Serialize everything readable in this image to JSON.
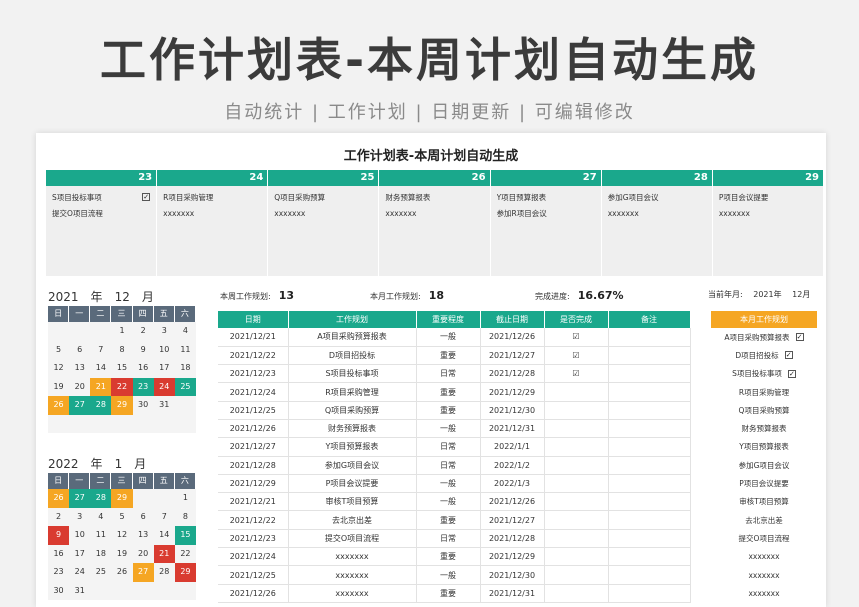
{
  "hero": {
    "title": "工作计划表-本周计划自动生成",
    "subtitle": "自动统计 | 工作计划 | 日期更新 | 可编辑修改"
  },
  "sheet": {
    "title": "工作计划表-本周计划自动生成"
  },
  "week": {
    "days": [
      "23",
      "24",
      "25",
      "26",
      "27",
      "28",
      "29"
    ],
    "items": [
      [
        {
          "text": "S项目投标事项",
          "done": true
        },
        {
          "text": "提交O项目流程",
          "done": false
        }
      ],
      [
        {
          "text": "R项目采购管理",
          "done": false
        },
        {
          "text": "xxxxxxx",
          "done": false
        }
      ],
      [
        {
          "text": "Q项目采购预算",
          "done": false
        },
        {
          "text": "xxxxxxx",
          "done": false
        }
      ],
      [
        {
          "text": "财务预算报表",
          "done": false
        },
        {
          "text": "xxxxxxx",
          "done": false
        }
      ],
      [
        {
          "text": "Y项目预算报表",
          "done": false
        },
        {
          "text": "参加R项目会议",
          "done": false
        }
      ],
      [
        {
          "text": "参加G项目会议",
          "done": false
        },
        {
          "text": "xxxxxxx",
          "done": false
        }
      ],
      [
        {
          "text": "P项目会议提要",
          "done": false
        },
        {
          "text": "xxxxxxx",
          "done": false
        }
      ]
    ]
  },
  "calendars": [
    {
      "year": "2021",
      "year_label": "年",
      "month": "12",
      "month_label": "月",
      "dows": [
        "日",
        "一",
        "二",
        "三",
        "四",
        "五",
        "六"
      ],
      "days": [
        {
          "t": "",
          "c": ""
        },
        {
          "t": "",
          "c": ""
        },
        {
          "t": "",
          "c": ""
        },
        {
          "t": "1",
          "c": ""
        },
        {
          "t": "2",
          "c": ""
        },
        {
          "t": "3",
          "c": ""
        },
        {
          "t": "4",
          "c": ""
        },
        {
          "t": "5",
          "c": ""
        },
        {
          "t": "6",
          "c": ""
        },
        {
          "t": "7",
          "c": ""
        },
        {
          "t": "8",
          "c": ""
        },
        {
          "t": "9",
          "c": ""
        },
        {
          "t": "10",
          "c": ""
        },
        {
          "t": "11",
          "c": ""
        },
        {
          "t": "12",
          "c": ""
        },
        {
          "t": "13",
          "c": ""
        },
        {
          "t": "14",
          "c": ""
        },
        {
          "t": "15",
          "c": ""
        },
        {
          "t": "16",
          "c": ""
        },
        {
          "t": "17",
          "c": ""
        },
        {
          "t": "18",
          "c": ""
        },
        {
          "t": "19",
          "c": ""
        },
        {
          "t": "20",
          "c": ""
        },
        {
          "t": "21",
          "c": "orange"
        },
        {
          "t": "22",
          "c": "red"
        },
        {
          "t": "23",
          "c": "green"
        },
        {
          "t": "24",
          "c": "red"
        },
        {
          "t": "25",
          "c": "green"
        },
        {
          "t": "26",
          "c": "orange"
        },
        {
          "t": "27",
          "c": "green"
        },
        {
          "t": "28",
          "c": "green"
        },
        {
          "t": "29",
          "c": "orange"
        },
        {
          "t": "30",
          "c": ""
        },
        {
          "t": "31",
          "c": ""
        },
        {
          "t": "",
          "c": ""
        },
        {
          "t": "",
          "c": ""
        },
        {
          "t": "",
          "c": ""
        },
        {
          "t": "",
          "c": ""
        },
        {
          "t": "",
          "c": ""
        },
        {
          "t": "",
          "c": ""
        },
        {
          "t": "",
          "c": ""
        },
        {
          "t": "",
          "c": ""
        }
      ]
    },
    {
      "year": "2022",
      "year_label": "年",
      "month": "1",
      "month_label": "月",
      "dows": [
        "日",
        "一",
        "二",
        "三",
        "四",
        "五",
        "六"
      ],
      "days": [
        {
          "t": "26",
          "c": "orange"
        },
        {
          "t": "27",
          "c": "green"
        },
        {
          "t": "28",
          "c": "green"
        },
        {
          "t": "29",
          "c": "orange"
        },
        {
          "t": "",
          "c": ""
        },
        {
          "t": "",
          "c": ""
        },
        {
          "t": "1",
          "c": ""
        },
        {
          "t": "2",
          "c": ""
        },
        {
          "t": "3",
          "c": ""
        },
        {
          "t": "4",
          "c": ""
        },
        {
          "t": "5",
          "c": ""
        },
        {
          "t": "6",
          "c": ""
        },
        {
          "t": "7",
          "c": ""
        },
        {
          "t": "8",
          "c": ""
        },
        {
          "t": "9",
          "c": "red"
        },
        {
          "t": "10",
          "c": ""
        },
        {
          "t": "11",
          "c": ""
        },
        {
          "t": "12",
          "c": ""
        },
        {
          "t": "13",
          "c": ""
        },
        {
          "t": "14",
          "c": ""
        },
        {
          "t": "15",
          "c": "green"
        },
        {
          "t": "16",
          "c": ""
        },
        {
          "t": "17",
          "c": ""
        },
        {
          "t": "18",
          "c": ""
        },
        {
          "t": "19",
          "c": ""
        },
        {
          "t": "20",
          "c": ""
        },
        {
          "t": "21",
          "c": "red"
        },
        {
          "t": "22",
          "c": ""
        },
        {
          "t": "23",
          "c": ""
        },
        {
          "t": "24",
          "c": ""
        },
        {
          "t": "25",
          "c": ""
        },
        {
          "t": "26",
          "c": ""
        },
        {
          "t": "27",
          "c": "orange"
        },
        {
          "t": "28",
          "c": ""
        },
        {
          "t": "29",
          "c": "red"
        },
        {
          "t": "30",
          "c": ""
        },
        {
          "t": "31",
          "c": ""
        },
        {
          "t": "",
          "c": ""
        },
        {
          "t": "",
          "c": ""
        },
        {
          "t": "",
          "c": ""
        },
        {
          "t": "",
          "c": ""
        },
        {
          "t": "",
          "c": ""
        }
      ]
    }
  ],
  "stats": {
    "week_label": "本周工作规划:",
    "week_value": "13",
    "month_label": "本月工作规划:",
    "month_value": "18",
    "progress_label": "完成进度:",
    "progress_value": "16.67%",
    "current_label": "当前年月:",
    "current_year": "2021年",
    "current_month": "12月"
  },
  "table": {
    "headers": [
      "日期",
      "工作规划",
      "重要程度",
      "截止日期",
      "是否完成",
      "备注"
    ],
    "rows": [
      [
        "2021/12/21",
        "A项目采购预算报表",
        "一般",
        "2021/12/26",
        "☑",
        ""
      ],
      [
        "2021/12/22",
        "D项目招投标",
        "重要",
        "2021/12/27",
        "☑",
        ""
      ],
      [
        "2021/12/23",
        "S项目投标事项",
        "日常",
        "2021/12/28",
        "☑",
        ""
      ],
      [
        "2021/12/24",
        "R项目采购管理",
        "重要",
        "2021/12/29",
        "",
        ""
      ],
      [
        "2021/12/25",
        "Q项目采购预算",
        "重要",
        "2021/12/30",
        "",
        ""
      ],
      [
        "2021/12/26",
        "财务预算报表",
        "一般",
        "2021/12/31",
        "",
        ""
      ],
      [
        "2021/12/27",
        "Y项目预算报表",
        "日常",
        "2022/1/1",
        "",
        ""
      ],
      [
        "2021/12/28",
        "参加G项目会议",
        "日常",
        "2022/1/2",
        "",
        ""
      ],
      [
        "2021/12/29",
        "P项目会议提要",
        "一般",
        "2022/1/3",
        "",
        ""
      ],
      [
        "2021/12/21",
        "审核T项目预算",
        "一般",
        "2021/12/26",
        "",
        ""
      ],
      [
        "2021/12/22",
        "去北京出差",
        "重要",
        "2021/12/27",
        "",
        ""
      ],
      [
        "2021/12/23",
        "提交O项目流程",
        "日常",
        "2021/12/28",
        "",
        ""
      ],
      [
        "2021/12/24",
        "xxxxxxx",
        "重要",
        "2021/12/29",
        "",
        ""
      ],
      [
        "2021/12/25",
        "xxxxxxx",
        "一般",
        "2021/12/30",
        "",
        ""
      ],
      [
        "2021/12/26",
        "xxxxxxx",
        "重要",
        "2021/12/31",
        "",
        ""
      ]
    ]
  },
  "month_panel": {
    "title": "本月工作规划",
    "items": [
      {
        "text": "A项目采购预算报表",
        "done": true
      },
      {
        "text": "D项目招投标",
        "done": true
      },
      {
        "text": "S项目投标事项",
        "done": true
      },
      {
        "text": "R项目采购管理",
        "done": false
      },
      {
        "text": "Q项目采购预算",
        "done": false
      },
      {
        "text": "财务预算报表",
        "done": false
      },
      {
        "text": "Y项目预算报表",
        "done": false
      },
      {
        "text": "参加G项目会议",
        "done": false
      },
      {
        "text": "P项目会议提要",
        "done": false
      },
      {
        "text": "审核T项目预算",
        "done": false
      },
      {
        "text": "去北京出差",
        "done": false
      },
      {
        "text": "提交O项目流程",
        "done": false
      },
      {
        "text": "xxxxxxx",
        "done": false
      },
      {
        "text": "xxxxxxx",
        "done": false
      },
      {
        "text": "xxxxxxx",
        "done": false
      }
    ]
  }
}
